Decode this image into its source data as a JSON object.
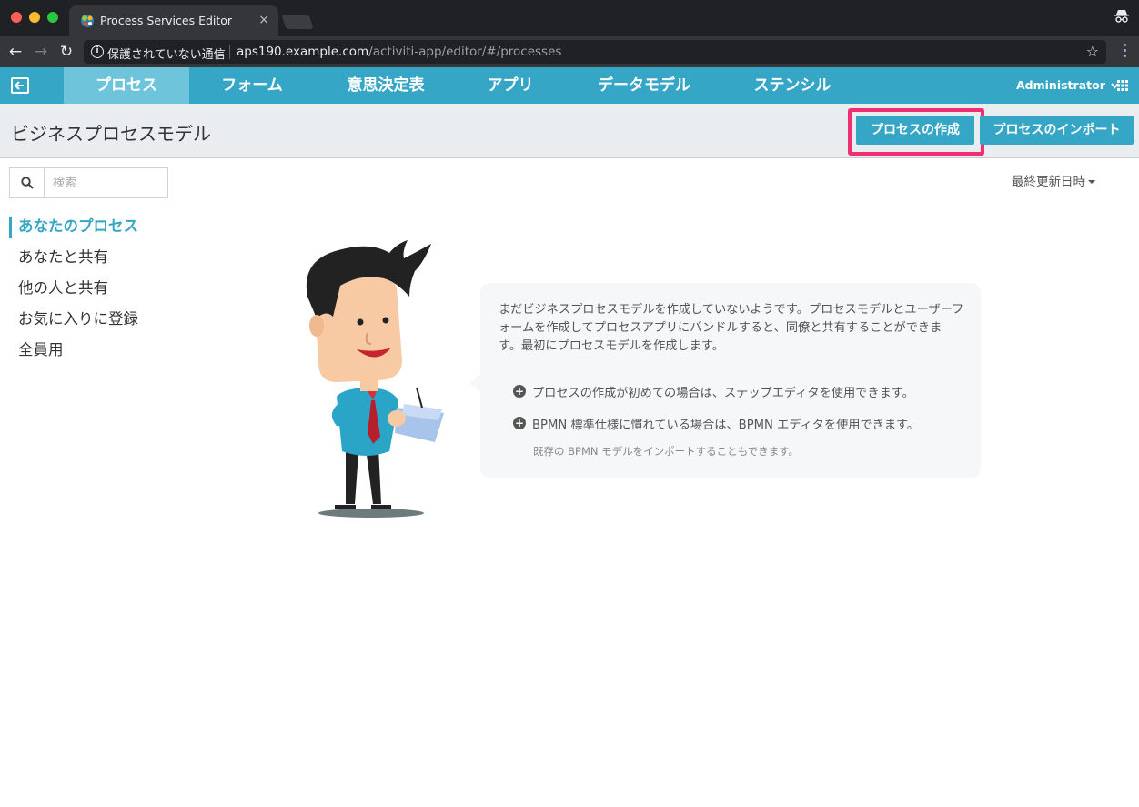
{
  "browser": {
    "tab_title": "Process Services Editor",
    "tab_close": "×",
    "security_label": "保護されていない通信",
    "url_host": "aps190.example.com",
    "url_path": "/activiti-app/editor/#/processes"
  },
  "nav": {
    "tabs": [
      {
        "label": "プロセス",
        "active": true
      },
      {
        "label": "フォーム"
      },
      {
        "label": "意思決定表"
      },
      {
        "label": "アプリ"
      },
      {
        "label": "データモデル"
      },
      {
        "label": "ステンシル"
      }
    ],
    "user": "Administrator"
  },
  "header": {
    "title": "ビジネスプロセスモデル",
    "create_button": "プロセスの作成",
    "import_button": "プロセスのインポート"
  },
  "search": {
    "placeholder": "検索"
  },
  "filters": [
    "あなたのプロセス",
    "あなたと共有",
    "他の人と共有",
    "お気に入りに登録",
    "全員用"
  ],
  "sort": {
    "label": "最終更新日時"
  },
  "empty_state": {
    "message": "まだビジネスプロセスモデルを作成していないようです。プロセスモデルとユーザーフォームを作成してプロセスアプリにバンドルすると、同僚と共有することができます。最初にプロセスモデルを作成します。",
    "hint_step_editor": "プロセスの作成が初めての場合は、ステップエディタを使用できます。",
    "hint_bpmn_editor": "BPMN 標準仕様に慣れている場合は、BPMN エディタを使用できます。",
    "hint_import": "既存の BPMN モデルをインポートすることもできます。"
  },
  "colors": {
    "accent": "#36a6c6",
    "active_tab": "#6ec4da",
    "highlight": "#ef2f72"
  }
}
